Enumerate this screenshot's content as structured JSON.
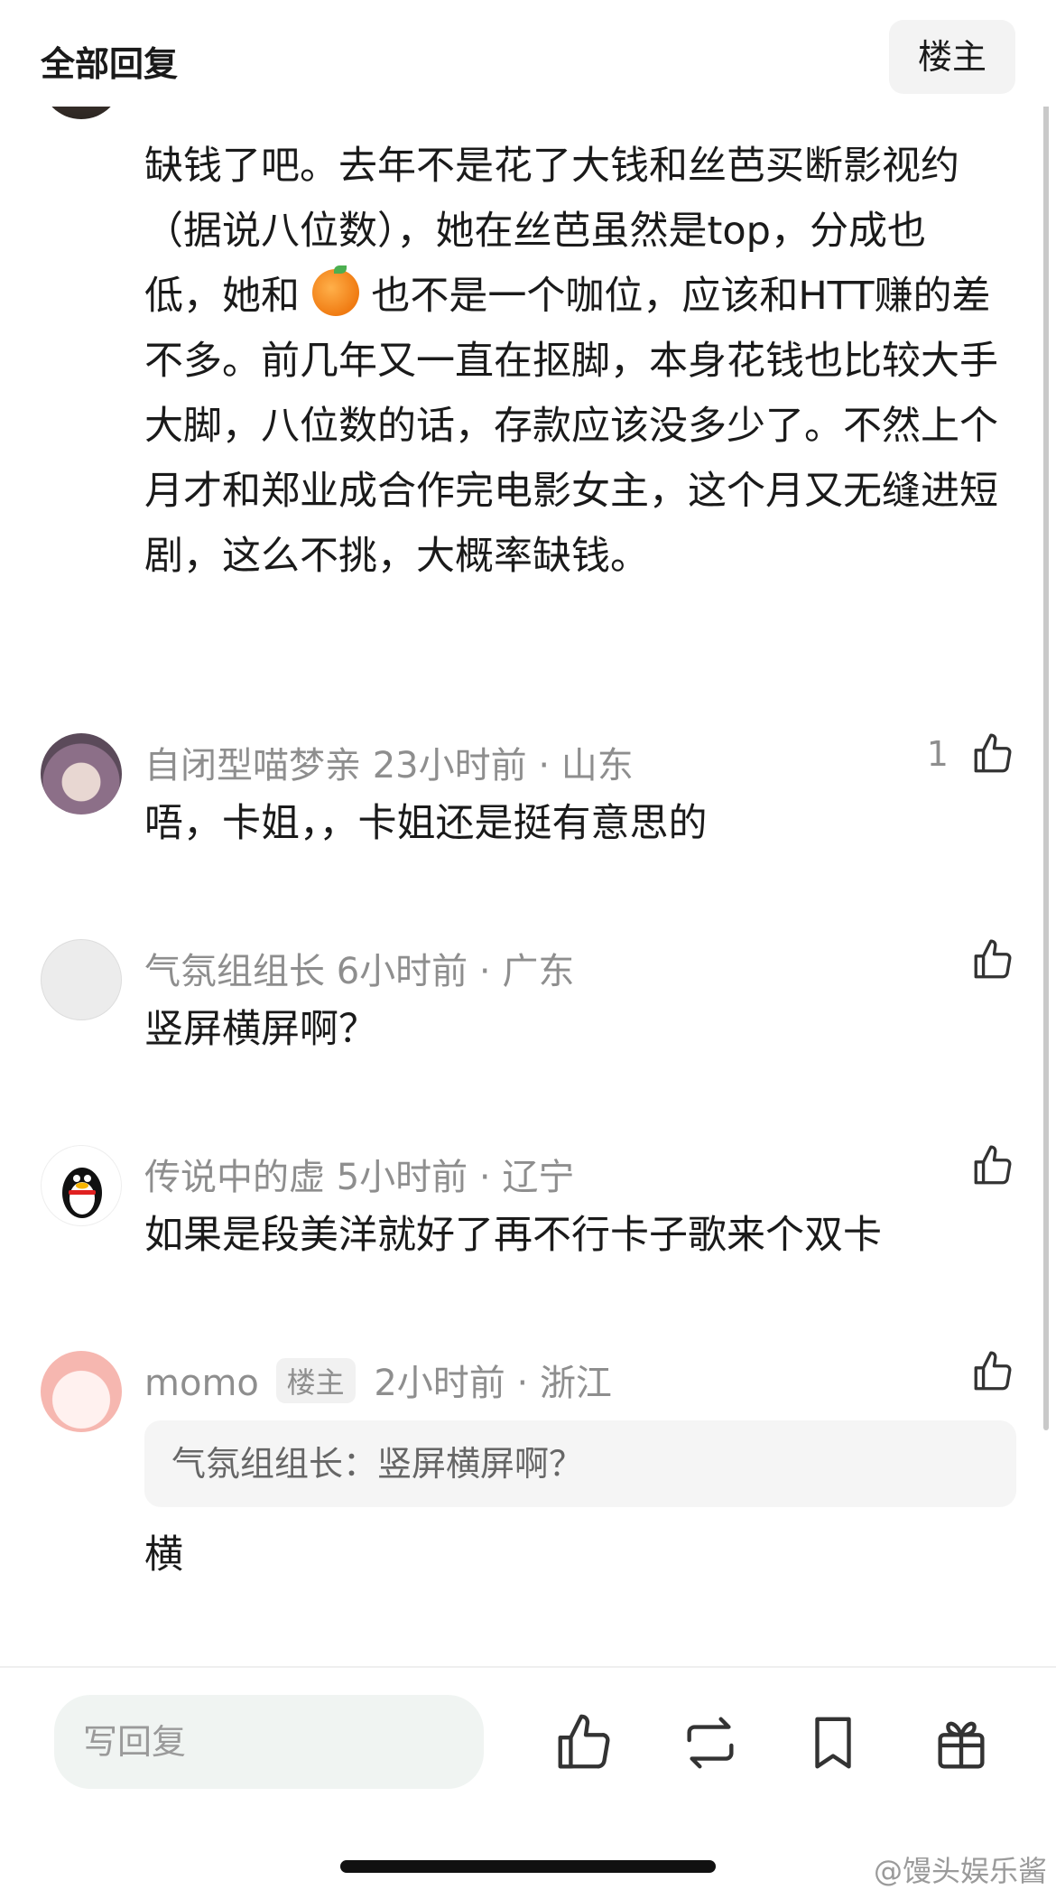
{
  "header": {
    "title": "全部回复",
    "op_button": "楼主"
  },
  "first_comment": {
    "text_before_emoji": "缺钱了吧。去年不是花了大钱和丝芭买断影视约（据说八位数），她在丝芭虽然是top，分成也低，她和",
    "emoji": "orange-emoji",
    "text_after_emoji": "也不是一个咖位，应该和HTT赚的差不多。前几年又一直在抠脚，本身花钱也比较大手大脚，八位数的话，存款应该没多少了。不然上个月才和郑业成合作完电影女主，这个月又无缝进短剧，这么不挑，大概率缺钱。"
  },
  "comments": [
    {
      "name": "自闭型喵梦亲",
      "time": "23小时前",
      "location": "山东",
      "sep": "·",
      "text": "唔，卡姐，，卡姐还是挺有意思的",
      "likes": "1"
    },
    {
      "name": "气氛组组长",
      "time": "6小时前",
      "location": "广东",
      "sep": "·",
      "text": "竖屏横屏啊？",
      "likes": ""
    },
    {
      "name": "传说中的虚",
      "time": "5小时前",
      "location": "辽宁",
      "sep": "·",
      "text": "如果是段美洋就好了再不行卡子歌来个双卡",
      "likes": ""
    },
    {
      "name": "momo",
      "badge": "楼主",
      "time": "2小时前",
      "location": "浙江",
      "sep": "·",
      "quote": "气氛组组长：竖屏横屏啊？",
      "text": "横",
      "likes": ""
    }
  ],
  "bottom_bar": {
    "reply_placeholder": "写回复",
    "watermark": "@馒头娱乐酱"
  },
  "colors": {
    "meta_gray": "#8e8e8e",
    "text": "#1a1a1a",
    "quote_bg": "#f5f5f5",
    "input_bg": "#f0f4f2"
  }
}
